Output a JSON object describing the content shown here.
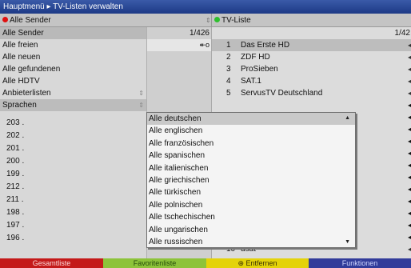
{
  "title_bar": {
    "breadcrumb": "Hauptmenü ▸ TV-Listen verwalten"
  },
  "header": {
    "left_label": "Alle Sender",
    "right_label": "TV-Liste",
    "dot_left_color": "#e01010",
    "dot_right_color": "#2ec02e"
  },
  "left_menu": {
    "items": [
      {
        "label": "Alle Sender"
      },
      {
        "label": "Alle freien"
      },
      {
        "label": "Alle neuen"
      },
      {
        "label": "Alle gefundenen"
      },
      {
        "label": "Alle HDTV"
      },
      {
        "label": "Anbieterlisten"
      },
      {
        "label": "Sprachen"
      }
    ],
    "count": "1/426"
  },
  "left_numbers": [
    "203 .",
    "202 .",
    "201 .",
    "200 .",
    "199 .",
    "212 .",
    "211 .",
    "198 .",
    "197 .",
    "196 ."
  ],
  "mid_marker": "↞o",
  "tv_list": {
    "count": "1/42",
    "channels": [
      {
        "num": "1",
        "name": "Das Erste HD"
      },
      {
        "num": "2",
        "name": "ZDF HD"
      },
      {
        "num": "3",
        "name": "ProSieben"
      },
      {
        "num": "4",
        "name": "SAT.1"
      },
      {
        "num": "5",
        "name": "ServusTV Deutschland"
      }
    ],
    "partial_last": {
      "num": "10",
      "name": "dsat"
    }
  },
  "language_dropdown": {
    "items": [
      "Alle deutschen",
      "Alle englischen",
      "Alle französischen",
      "Alle spanischen",
      "Alle italienischen",
      "Alle griechischen",
      "Alle türkischen",
      "Alle polnischen",
      "Alle tschechischen",
      "Alle ungarischen",
      "Alle russischen"
    ],
    "selected": "Alle deutschen"
  },
  "footer": {
    "red": "Gesamtliste",
    "green": "Favoritenliste",
    "yellow": "⊕ Entfernen",
    "blue": "Funktionen"
  },
  "colors": {
    "title_bar": "#1d3a86",
    "footer_red": "#c41a1a",
    "footer_green": "#8dc33a",
    "footer_yellow": "#e4d30a",
    "footer_blue": "#323c9a"
  }
}
